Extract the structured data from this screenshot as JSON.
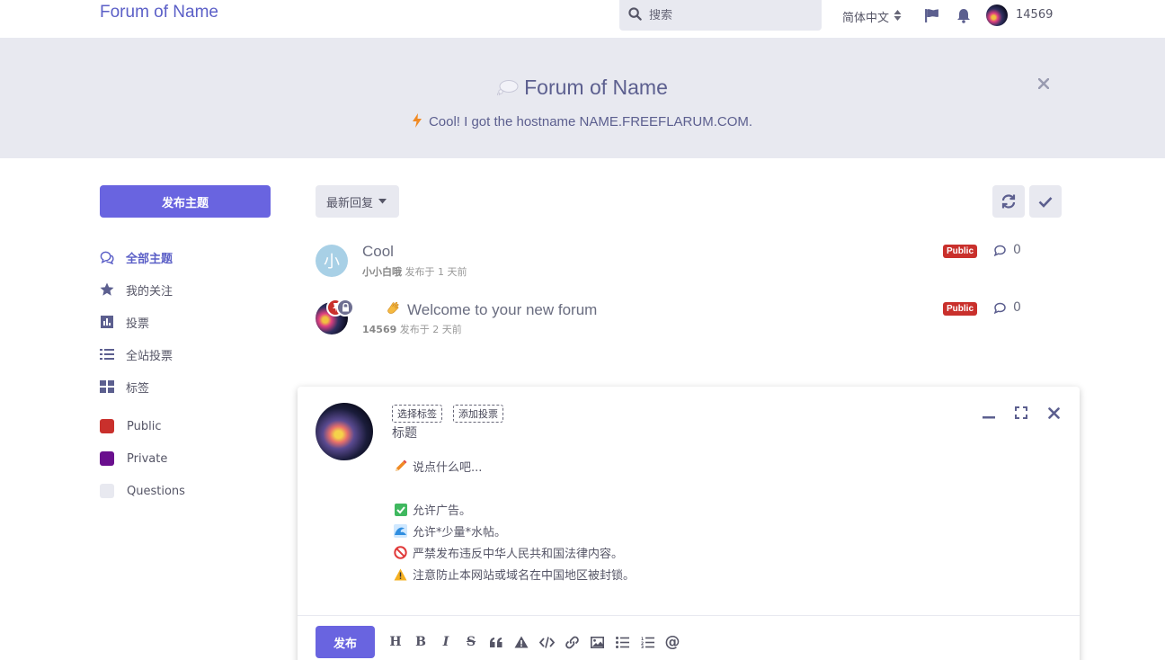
{
  "header": {
    "brand": "Forum of Name",
    "search_placeholder": "搜索",
    "language": "简体中文",
    "username": "14569"
  },
  "hero": {
    "title": "Forum of Name",
    "subtitle": "Cool! I got the hostname NAME.FREEFLARUM.COM."
  },
  "sidebar": {
    "new_discussion": "发布主题",
    "nav": [
      {
        "label": "全部主题",
        "icon": "chat-bubbles-icon",
        "active": true
      },
      {
        "label": "我的关注",
        "icon": "star-icon"
      },
      {
        "label": "投票",
        "icon": "bar-chart-icon"
      },
      {
        "label": "全站投票",
        "icon": "list-icon"
      },
      {
        "label": "标签",
        "icon": "grid-icon"
      }
    ],
    "tags": [
      {
        "label": "Public",
        "color": "#c9302c"
      },
      {
        "label": "Private",
        "color": "#6a0f8e"
      },
      {
        "label": "Questions",
        "color": "#e8e9f0"
      }
    ]
  },
  "toolbar": {
    "sort_label": "最新回复"
  },
  "discussions": [
    {
      "title": "Cool",
      "avatar_letter": "小",
      "author": "小小白哦",
      "meta": "发布于 1 天前",
      "tag": "Public",
      "replies": "0"
    },
    {
      "title": "Welcome to your new forum",
      "emoji": "👋",
      "author": "14569",
      "meta": "发布于 2 天前",
      "tag": "Public",
      "replies": "0"
    }
  ],
  "composer": {
    "chip_tags": "选择标签",
    "chip_poll": "添加投票",
    "title_placeholder": "标题",
    "body_prompt": "说点什么吧...",
    "rules": [
      "允许广告。",
      "允许*少量*水帖。",
      "严禁发布违反中华人民共和国法律内容。",
      "注意防止本网站或域名在中国地区被封锁。"
    ],
    "publish": "发布"
  },
  "colors": {
    "accent": "#6964e0",
    "brand": "#5b5fc7",
    "hero_bg": "#e8e9f0",
    "public_badge": "#c9302c"
  }
}
